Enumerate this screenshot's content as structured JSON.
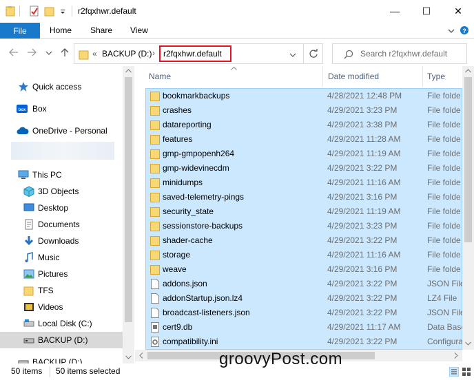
{
  "window": {
    "title": "r2fqxhwr.default",
    "minimize": "—",
    "maximize": "☐",
    "close": "✕"
  },
  "ribbon": {
    "tabs": [
      "File",
      "Home",
      "Share",
      "View"
    ],
    "expand_icon": "chevron-down-icon",
    "help_icon": "help-icon"
  },
  "address": {
    "overflow": "«",
    "segments": [
      "BACKUP (D:)",
      "r2fqxhwr.default"
    ],
    "search_placeholder": "Search r2fqxhwr.default"
  },
  "nav_pane": {
    "items": [
      {
        "label": "Quick access",
        "icon": "star-icon"
      },
      {
        "label": "Box",
        "icon": "box-icon"
      },
      {
        "label": "OneDrive - Personal",
        "icon": "cloud-icon"
      },
      {
        "label": "This PC",
        "icon": "computer-icon"
      },
      {
        "label": "3D Objects",
        "icon": "cube-icon"
      },
      {
        "label": "Desktop",
        "icon": "desktop-icon"
      },
      {
        "label": "Documents",
        "icon": "documents-icon"
      },
      {
        "label": "Downloads",
        "icon": "download-icon"
      },
      {
        "label": "Music",
        "icon": "music-icon"
      },
      {
        "label": "Pictures",
        "icon": "pictures-icon"
      },
      {
        "label": "TFS",
        "icon": "folder-icon"
      },
      {
        "label": "Videos",
        "icon": "videos-icon"
      },
      {
        "label": "Local Disk (C:)",
        "icon": "drive-icon"
      },
      {
        "label": "BACKUP (D:)",
        "icon": "drive-icon"
      },
      {
        "label": "BACKUP (D:)",
        "icon": "drive-icon"
      }
    ],
    "selected_index": 13
  },
  "columns": {
    "name": "Name",
    "date": "Date modified",
    "type": "Type"
  },
  "files": [
    {
      "name": "bookmarkbackups",
      "date": "4/28/2021 12:48 PM",
      "type": "File folde",
      "kind": "folder"
    },
    {
      "name": "crashes",
      "date": "4/29/2021 3:23 PM",
      "type": "File folde",
      "kind": "folder"
    },
    {
      "name": "datareporting",
      "date": "4/29/2021 3:38 PM",
      "type": "File folde",
      "kind": "folder"
    },
    {
      "name": "features",
      "date": "4/29/2021 11:28 AM",
      "type": "File folde",
      "kind": "folder"
    },
    {
      "name": "gmp-gmpopenh264",
      "date": "4/29/2021 11:19 AM",
      "type": "File folde",
      "kind": "folder"
    },
    {
      "name": "gmp-widevinecdm",
      "date": "4/29/2021 3:22 PM",
      "type": "File folde",
      "kind": "folder"
    },
    {
      "name": "minidumps",
      "date": "4/29/2021 11:16 AM",
      "type": "File folde",
      "kind": "folder"
    },
    {
      "name": "saved-telemetry-pings",
      "date": "4/29/2021 3:16 PM",
      "type": "File folde",
      "kind": "folder"
    },
    {
      "name": "security_state",
      "date": "4/29/2021 11:19 AM",
      "type": "File folde",
      "kind": "folder"
    },
    {
      "name": "sessionstore-backups",
      "date": "4/29/2021 3:23 PM",
      "type": "File folde",
      "kind": "folder"
    },
    {
      "name": "shader-cache",
      "date": "4/29/2021 3:22 PM",
      "type": "File folde",
      "kind": "folder"
    },
    {
      "name": "storage",
      "date": "4/29/2021 11:16 AM",
      "type": "File folde",
      "kind": "folder"
    },
    {
      "name": "weave",
      "date": "4/29/2021 3:16 PM",
      "type": "File folde",
      "kind": "folder"
    },
    {
      "name": "addons.json",
      "date": "4/29/2021 3:22 PM",
      "type": "JSON File",
      "kind": "file"
    },
    {
      "name": "addonStartup.json.lz4",
      "date": "4/29/2021 3:22 PM",
      "type": "LZ4 File",
      "kind": "file"
    },
    {
      "name": "broadcast-listeners.json",
      "date": "4/29/2021 3:22 PM",
      "type": "JSON File",
      "kind": "file"
    },
    {
      "name": "cert9.db",
      "date": "4/29/2021 11:17 AM",
      "type": "Data Base",
      "kind": "db"
    },
    {
      "name": "compatibility.ini",
      "date": "4/29/2021 3:22 PM",
      "type": "Configura",
      "kind": "ini"
    }
  ],
  "status": {
    "items": "50 items",
    "selected": "50 items selected"
  },
  "watermark": "groovyPost.com",
  "colors": {
    "accent": "#1979ca",
    "selection": "#cce8ff",
    "selection_border": "#99d1ff",
    "folder": "#f8d775",
    "highlight_box": "#e81123"
  }
}
